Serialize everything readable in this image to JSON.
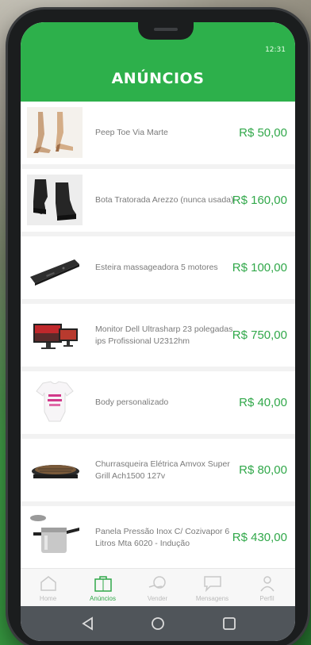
{
  "status_bar": {
    "time": "12:31"
  },
  "header": {
    "title": "ANÚNCIOS"
  },
  "listings": [
    {
      "title": "Peep Toe Via Marte",
      "price": "R$ 50,00",
      "icon": "heels-photo"
    },
    {
      "title": "Bota Tratorada Arezzo (nunca usada)",
      "price": "R$ 160,00",
      "icon": "boots-photo"
    },
    {
      "title": "Esteira massageadora 5 motores",
      "price": "R$ 100,00",
      "icon": "massage-mat-photo"
    },
    {
      "title": "Monitor Dell Ultrasharp 23 polegadas ips Profissional U2312hm",
      "price": "R$ 750,00",
      "icon": "monitor-photo"
    },
    {
      "title": "Body personalizado",
      "price": "R$ 40,00",
      "icon": "baby-body-photo"
    },
    {
      "title": "Churrasqueira Elétrica Amvox Super Grill Ach1500 127v",
      "price": "R$ 80,00",
      "icon": "grill-photo"
    },
    {
      "title": "Panela Pressão Inox C/ Cozivapor 6 Litros Mta 6020 - Indução",
      "price": "R$ 430,00",
      "icon": "pressure-cooker-photo"
    }
  ],
  "tabs": [
    {
      "label": "Home",
      "icon": "home-icon",
      "active": false
    },
    {
      "label": "Anúncios",
      "icon": "bag-icon",
      "active": true
    },
    {
      "label": "Vender",
      "icon": "sell-icon",
      "active": false
    },
    {
      "label": "Mensagens",
      "icon": "message-icon",
      "active": false
    },
    {
      "label": "Perfil",
      "icon": "profile-icon",
      "active": false
    }
  ],
  "nav": {
    "back": "back-triangle-icon",
    "home": "home-circle-icon",
    "recents": "recents-square-icon"
  },
  "colors": {
    "brand_green": "#2db04b",
    "price_green": "#31a84a",
    "nav_bar": "#50555a"
  }
}
